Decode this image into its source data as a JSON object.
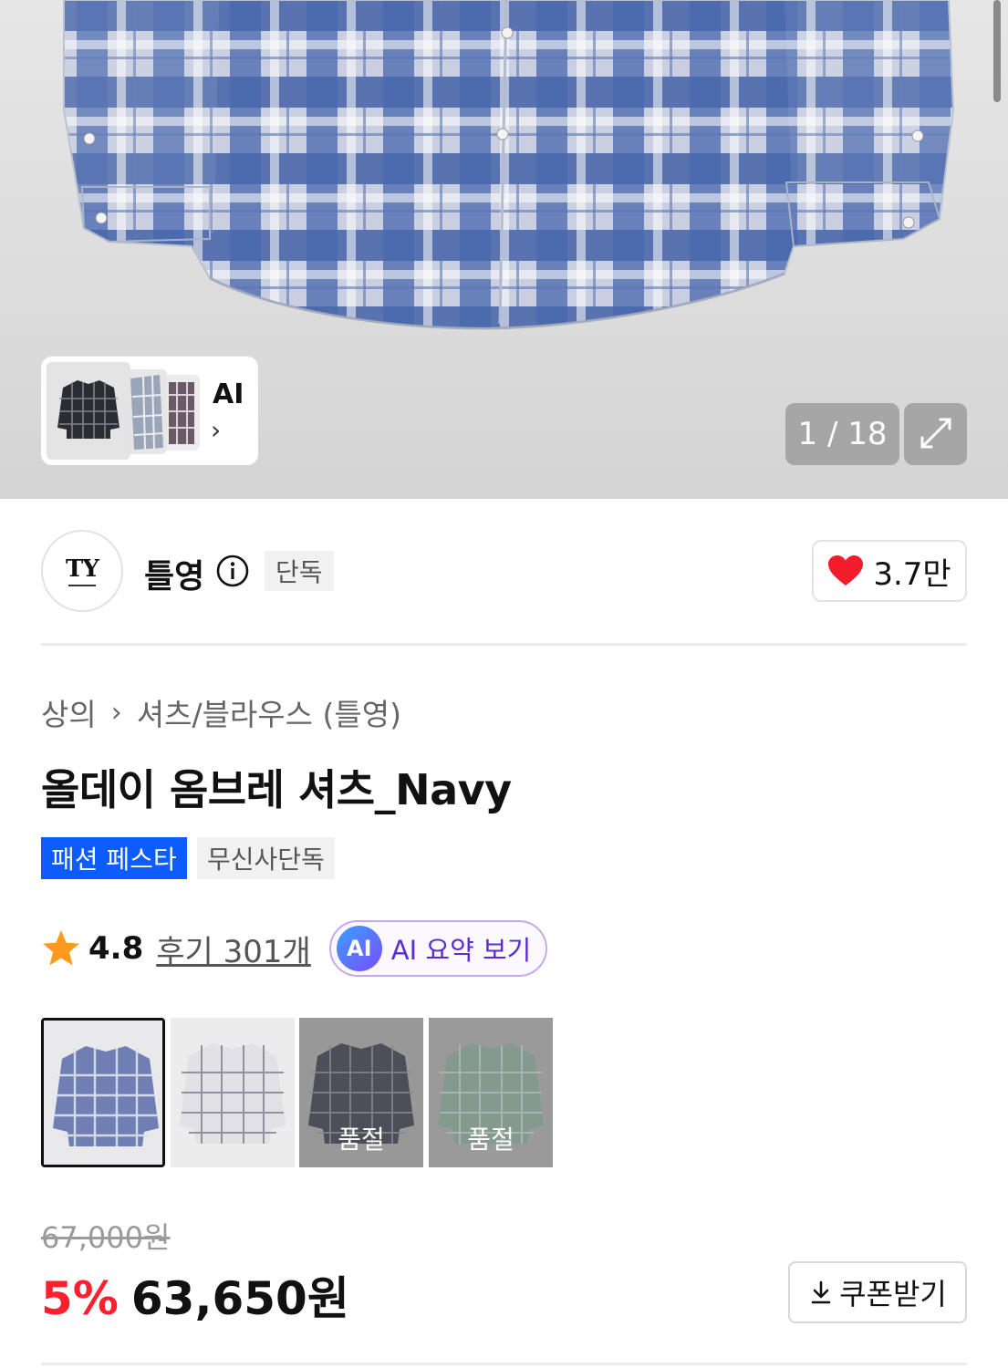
{
  "gallery": {
    "pager_text": "1 / 18",
    "ai_label": "AI",
    "ai_chevron": "›",
    "expand_icon": "expand-icon"
  },
  "brand": {
    "logo_text": "TY",
    "name": "틀영",
    "exclusive_chip": "단독",
    "likes": "3.7만"
  },
  "breadcrumb": {
    "category": "상의",
    "separator": "›",
    "subcategory": "셔츠/블라우스 (틀영)"
  },
  "product": {
    "title": "올데이 옴브레 셔츠_Navy",
    "tags": [
      "패션 페스타",
      "무신사단독"
    ],
    "rating": "4.8",
    "reviews_label": "후기 301개",
    "ai_badge": "AI",
    "ai_summary_label": "AI 요약 보기"
  },
  "color_options": [
    {
      "name": "Navy",
      "selected": true,
      "sold_out": false,
      "sold_out_label": ""
    },
    {
      "name": "White",
      "selected": false,
      "sold_out": false,
      "sold_out_label": ""
    },
    {
      "name": "Black",
      "selected": false,
      "sold_out": true,
      "sold_out_label": "품절"
    },
    {
      "name": "Green",
      "selected": false,
      "sold_out": true,
      "sold_out_label": "품절"
    }
  ],
  "price": {
    "original": "67,000원",
    "discount": "5%",
    "sale": "63,650원",
    "coupon_label": "쿠폰받기"
  },
  "colors": {
    "accent_blue": "#0d5cff",
    "discount_red": "#ff1f2d",
    "heart_red": "#f31c2b",
    "star_orange": "#ff9a1f"
  }
}
